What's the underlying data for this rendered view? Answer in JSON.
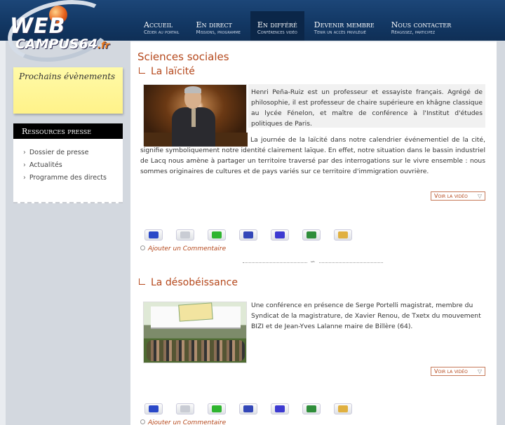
{
  "logo": {
    "line1": "WEB",
    "line2": "CAMPUS64",
    "suffix": ".fr"
  },
  "nav": [
    {
      "label": "Accueil",
      "sub": "Céder au portail"
    },
    {
      "label": "En direct",
      "sub": "Missions, programme"
    },
    {
      "label": "En différé",
      "sub": "Conférences vidéo"
    },
    {
      "label": "Devenir membre",
      "sub": "Tenir un accès privilégié"
    },
    {
      "label": "Nous contacter",
      "sub": "Réagissez, participez"
    }
  ],
  "sidebar": {
    "postit_title": "Prochains évènements",
    "resources_title": "Ressources presse",
    "resources": [
      "Dossier de presse",
      "Actualités",
      "Programme des directs"
    ]
  },
  "main": {
    "section_title": "Sciences sociales",
    "articles": [
      {
        "title": "La laïcité",
        "intro": "Henri Peña-Ruiz est un professeur et essayiste français. Agrégé de philosophie, il est professeur de chaire supérieure en khâgne classique au lycée Fénelon, et maître de conférence à l'Institut d'études politiques de Paris.",
        "body": "La journée de la laïcité dans notre calendrier événementiel de la cité, signifie symboliquement notre identité clairement laïque. En effet, notre situation dans le bassin industriel de Lacq nous amène à partager un territoire traversé par des interrogations sur le vivre ensemble : nous sommes originaires de cultures et de pays variés sur ce territoire d'immigration ouvrière.",
        "video_btn": "Voir la vidéo",
        "comment": "Ajouter un Commentaire"
      },
      {
        "title": "La désobéissance",
        "intro": "Une conférence en présence de Serge Portelli magistrat, membre du Syndicat de la magistrature, de Xavier Renou, de Txetx du mouvement BIZI et de Jean-Yves Lalanne maire de Billère (64).",
        "video_btn": "Voir la vidéo",
        "comment": "Ajouter un Commentaire"
      }
    ],
    "separator_glyph": "∽"
  },
  "share_icons": [
    "delicious-icon",
    "digg-icon",
    "netvibes-icon",
    "myspace-icon",
    "facebook-icon",
    "scoopeo-icon",
    "google-icon"
  ],
  "share_colors": [
    "#2a48c8",
    "#c9ccd4",
    "#2fb52f",
    "#3347b8",
    "#3d3ad1",
    "#2f8e3a",
    "#e0b040"
  ],
  "colors": {
    "accent": "#b5481c",
    "header": "#123763"
  }
}
